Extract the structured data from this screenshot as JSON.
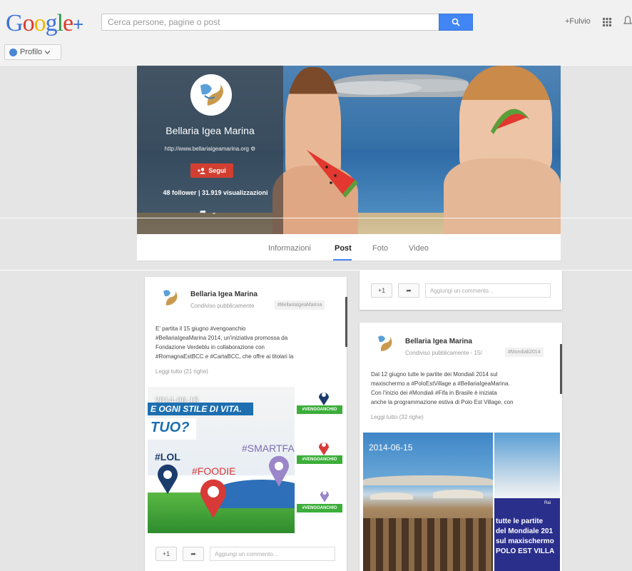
{
  "header": {
    "logo_letters": [
      "G",
      "o",
      "o",
      "g",
      "l",
      "e"
    ],
    "logo_plus": "+",
    "search_placeholder": "Cerca persone, pagine o post",
    "user_name": "+Fulvio",
    "profile_label": "Profilo"
  },
  "profile": {
    "name": "Bellaria Igea Marina",
    "url": "http://www.bellariaigeamarina.org",
    "follow_label": "Segui",
    "stats": "48 follower | 31.919 visualizzazioni"
  },
  "tabs": [
    {
      "label": "Informazioni",
      "active": false
    },
    {
      "label": "Post",
      "active": true
    },
    {
      "label": "Foto",
      "active": false
    },
    {
      "label": "Video",
      "active": false
    }
  ],
  "post1": {
    "author": "Bellaria Igea Marina",
    "visibility": "Condiviso pubblicamente",
    "hashtag": "#BellariaIgeaMarina",
    "text_lines": [
      "E' partita il 15 giugno #vengoanchio",
      "#BellariaIgeaMarina 2014, un'iniziativa promossa da",
      "Fondazione Verdeblu in collaborazione con",
      "#RomagnaEstBCC e #CartaBCC, che offre ai titolari la"
    ],
    "more": "Leggi tutto (21 righe)",
    "image_date": "2014-06-15",
    "image_banner": "E OGNI STILE DI VITA.",
    "image_tuo": "TUO?",
    "tag_lol": "#LOL",
    "tag_foodie": "#FOODIE",
    "tag_smart": "#SMARTFA",
    "side_label_1": "#VENGOANCHIO",
    "side_label_2": "#VENGOANCHIO",
    "side_label_3": "#VENGOANCHIO",
    "plus_one": "+1",
    "comment_placeholder": "Aggiungi un commento..."
  },
  "post0": {
    "plus_one": "+1",
    "comment_placeholder": "Aggiungi un commento..."
  },
  "post2": {
    "author": "Bellaria Igea Marina",
    "visibility": "Condiviso pubblicamente - 15/",
    "hashtag": "#Mondiali2014",
    "text_lines": [
      "Dal 12 giugno tutte le partite dei Mondiali 2014 sul",
      "maxischermo a #PoloEstVillage a #BellariaIgeaMarina.",
      "Con l'inizio dei #Mondiali #Fifa  in Brasile è iniziata",
      "anche la programmazione estiva di Polo Est Village, con"
    ],
    "more": "Leggi tutto (32 righe)",
    "image_date": "2014-06-15",
    "promo_lines": [
      "tutte le partite",
      "del Mondiale 201",
      "sul maxischermo",
      "POLO EST VILLA"
    ],
    "promo_small": "Rai"
  },
  "colors": {
    "accent_blue": "#4285f4",
    "follow_red": "#d23f31",
    "banner_blue": "#1d6fb0",
    "tag_green": "#3cae3a"
  },
  "icons": [
    "search-icon",
    "apps-grid-icon",
    "bell-icon",
    "person-add-icon",
    "share-icon",
    "chevron-down-icon",
    "settings-icon"
  ]
}
